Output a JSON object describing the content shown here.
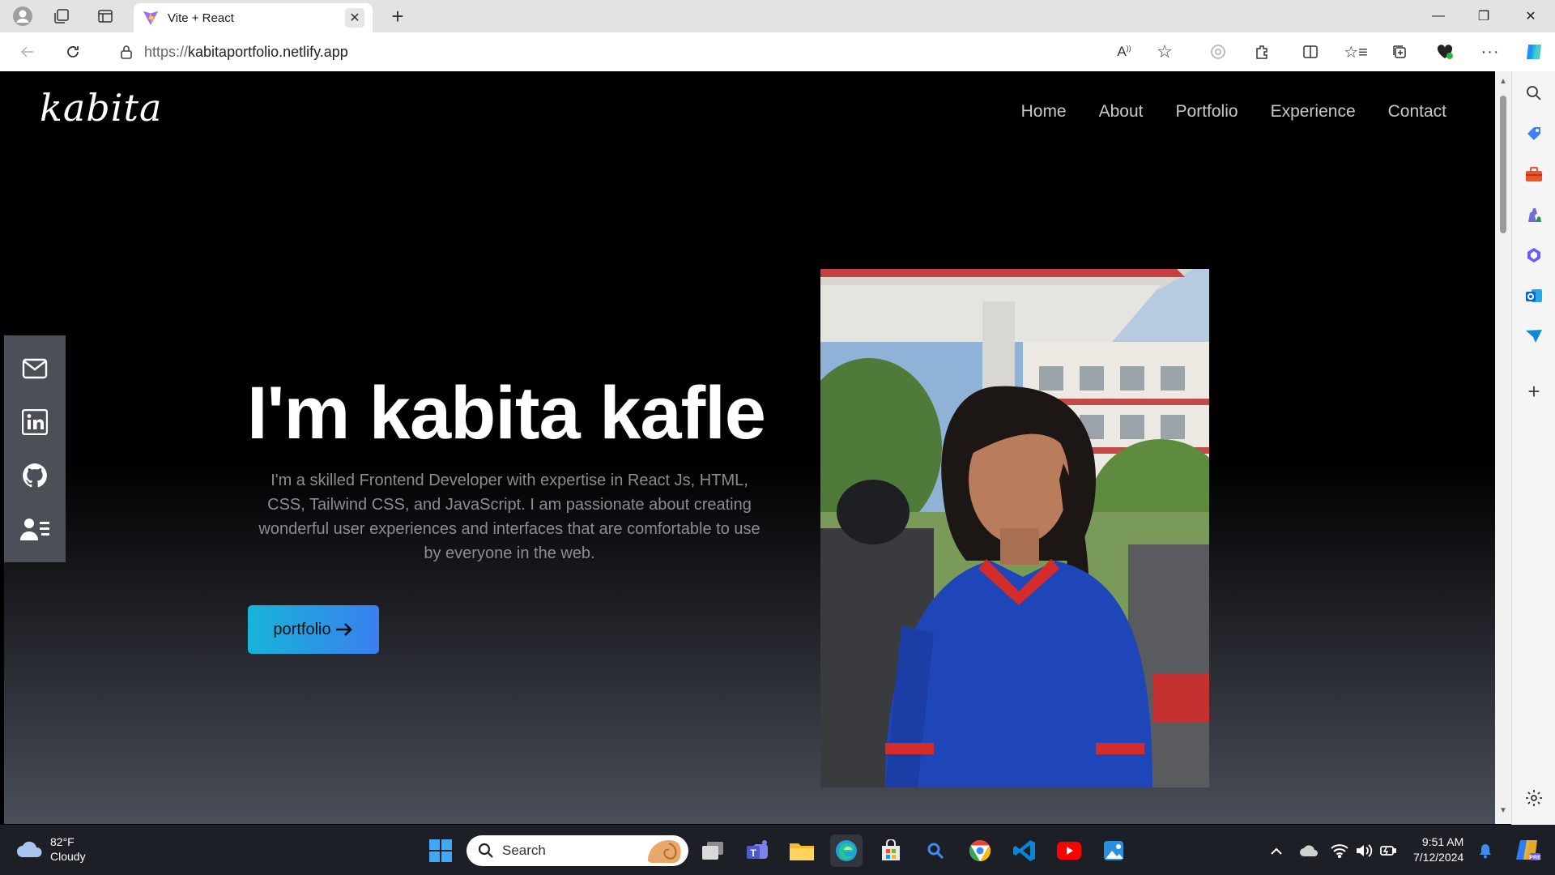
{
  "browser": {
    "tab_title": "Vite + React",
    "url_protocol": "https://",
    "url_host": "kabitaportfolio.netlify.app"
  },
  "site": {
    "logo": "kabita",
    "nav": [
      "Home",
      "About",
      "Portfolio",
      "Experience",
      "Contact"
    ],
    "social": [
      "mail-icon",
      "linkedin-icon",
      "github-icon",
      "contact-card-icon"
    ],
    "hero_title": "I'm kabita kafle",
    "hero_description": "I'm a skilled Frontend Developer with expertise in React Js, HTML, CSS, Tailwind CSS, and JavaScript. I am passionate about creating wonderful user experiences and interfaces that are comfortable to use by everyone in the web.",
    "cta_label": "portfolio",
    "colors": {
      "cta_start": "#16b4d8",
      "cta_end": "#3b7fef",
      "social_bg": "#4b4f57"
    }
  },
  "taskbar": {
    "temperature": "82°F",
    "condition": "Cloudy",
    "search_label": "Search",
    "time": "9:51 AM",
    "date": "7/12/2024"
  }
}
